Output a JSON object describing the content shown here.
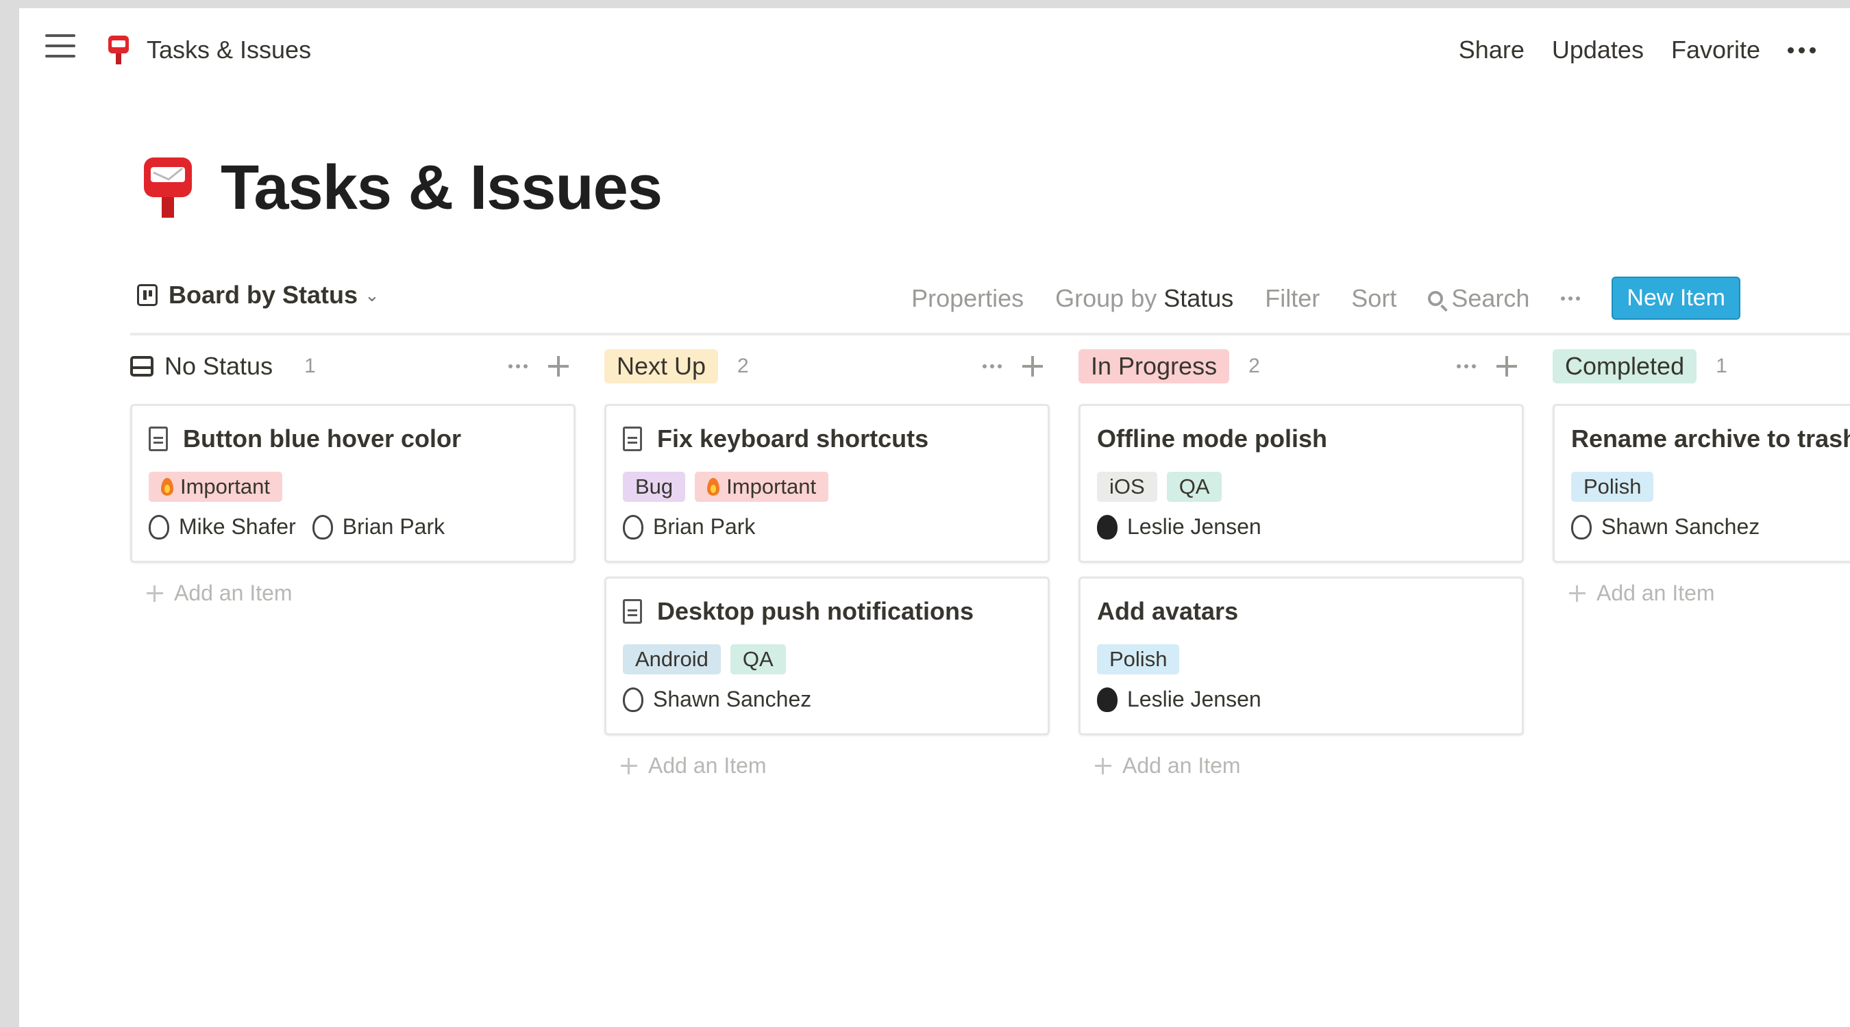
{
  "breadcrumb": {
    "title": "Tasks & Issues"
  },
  "topbar": {
    "share": "Share",
    "updates": "Updates",
    "favorite": "Favorite"
  },
  "page": {
    "title": "Tasks & Issues"
  },
  "view": {
    "label": "Board by Status",
    "properties": "Properties",
    "group_by_prefix": "Group by",
    "group_by_value": "Status",
    "filter": "Filter",
    "sort": "Sort",
    "search": "Search",
    "new_item": "New Item"
  },
  "add_item_label": "Add an Item",
  "columns": [
    {
      "label": "No Status",
      "count": "1",
      "color": "#ffffff",
      "cards": [
        {
          "title": "Button blue hover color",
          "doc": true,
          "tags": [
            {
              "label": "Important",
              "bg": "#fbd3d3",
              "flame": true
            }
          ],
          "people": [
            {
              "name": "Mike Shafer"
            },
            {
              "name": "Brian Park"
            }
          ]
        }
      ]
    },
    {
      "label": "Next Up",
      "count": "2",
      "color": "#fdecc8",
      "cards": [
        {
          "title": "Fix keyboard shortcuts",
          "doc": true,
          "tags": [
            {
              "label": "Bug",
              "bg": "#e8d5f2"
            },
            {
              "label": "Important",
              "bg": "#fbd3d3",
              "flame": true
            }
          ],
          "people": [
            {
              "name": "Brian Park"
            }
          ]
        },
        {
          "title": "Desktop push notifications",
          "doc": true,
          "tags": [
            {
              "label": "Android",
              "bg": "#d3e5ef"
            },
            {
              "label": "QA",
              "bg": "#d3eee4"
            }
          ],
          "people": [
            {
              "name": "Shawn Sanchez"
            }
          ]
        }
      ]
    },
    {
      "label": "In Progress",
      "count": "2",
      "color": "#fbcfd0",
      "cards": [
        {
          "title": "Offline mode polish",
          "doc": false,
          "tags": [
            {
              "label": "iOS",
              "bg": "#ebebea"
            },
            {
              "label": "QA",
              "bg": "#d3eee4"
            }
          ],
          "people": [
            {
              "name": "Leslie Jensen",
              "dark": true
            }
          ]
        },
        {
          "title": "Add avatars",
          "doc": false,
          "tags": [
            {
              "label": "Polish",
              "bg": "#d4ecf7"
            }
          ],
          "people": [
            {
              "name": "Leslie Jensen",
              "dark": true
            }
          ]
        }
      ]
    },
    {
      "label": "Completed",
      "count": "1",
      "color": "#d3eee4",
      "cards": [
        {
          "title": "Rename archive to trash",
          "doc": false,
          "tags": [
            {
              "label": "Polish",
              "bg": "#d4ecf7"
            }
          ],
          "people": [
            {
              "name": "Shawn Sanchez"
            }
          ]
        }
      ]
    }
  ]
}
